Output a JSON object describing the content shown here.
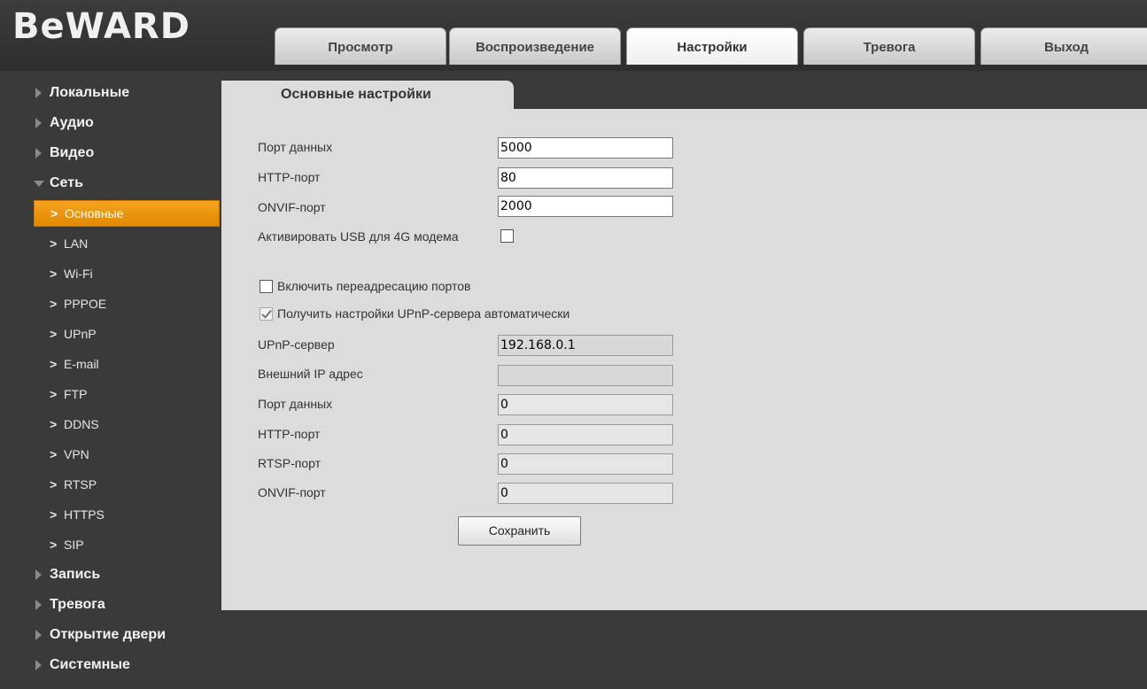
{
  "logo": "BeWARD",
  "tabs": [
    "Просмотр",
    "Воспроизведение",
    "Настройки",
    "Тревога",
    "Выход"
  ],
  "active_tab": "Настройки",
  "sidebar": {
    "top_sections": [
      "Локальные",
      "Аудио",
      "Видео",
      "Сеть"
    ],
    "network_items": [
      "Основные",
      "LAN",
      "Wi-Fi",
      "PPPOE",
      "UPnP",
      "E-mail",
      "FTP",
      "DDNS",
      "VPN",
      "RTSP",
      "HTTPS",
      "SIP"
    ],
    "bottom_sections": [
      "Запись",
      "Тревога",
      "Открытие двери",
      "Системные"
    ],
    "active_item": "Основные"
  },
  "panel": {
    "title": "Основные настройки",
    "data_port_label": "Порт данных",
    "data_port_value": "5000",
    "http_port_label": "HTTP-порт",
    "http_port_value": "80",
    "onvif_port_label": "ONVIF-порт",
    "onvif_port_value": "2000",
    "usb_4g_label": "Активировать USB для 4G модема",
    "usb_4g_checked": false,
    "port_forward_label": "Включить переадресацию портов",
    "port_forward_checked": false,
    "upnp_auto_label": "Получить настройки UPnP-сервера автоматически",
    "upnp_auto_checked": true,
    "upnp_server_label": "UPnP-сервер",
    "upnp_server_value": "192.168.0.1",
    "external_ip_label": "Внешний IP адрес",
    "external_ip_value": "",
    "ext_data_port_label": "Порт данных",
    "ext_data_port_value": "0",
    "ext_http_port_label": "HTTP-порт",
    "ext_http_port_value": "0",
    "ext_rtsp_port_label": "RTSP-порт",
    "ext_rtsp_port_value": "0",
    "ext_onvif_port_label": "ONVIF-порт",
    "ext_onvif_port_value": "0",
    "save_label": "Сохранить"
  },
  "colors": {
    "background": "#3a3a3a",
    "panel": "#dcdcdc",
    "accent": "#f39c12"
  }
}
